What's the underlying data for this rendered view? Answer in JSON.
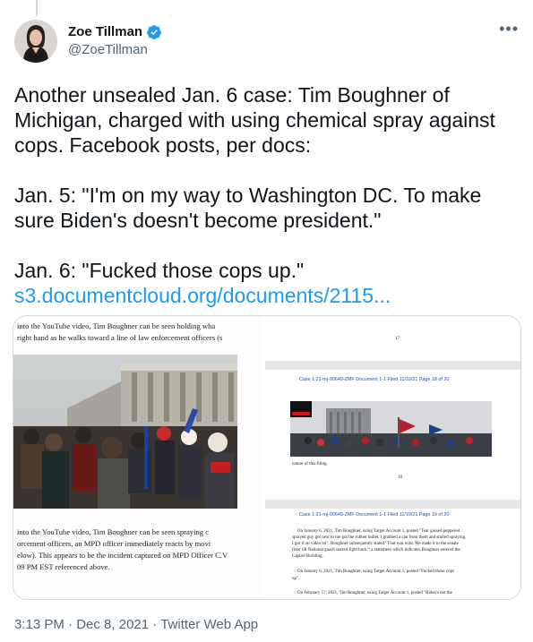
{
  "author": {
    "display_name": "Zoe Tillman",
    "handle": "@ZoeTillman",
    "verified": true,
    "verified_icon": "verified-badge-icon"
  },
  "more_icon": "ellipsis-icon",
  "tweet": {
    "paragraph_1": "Another unsealed Jan. 6 case: Tim Boughner of Michigan, charged with using chemical spray against cops. Facebook posts, per docs:",
    "paragraph_2": "Jan. 5: \"I'm on my way to Washington DC. To make sure Biden's doesn't become president.\"",
    "paragraph_3": "Jan. 6: \"Fucked those cops up.\"",
    "link": "s3.documentcloud.org/documents/2115..."
  },
  "media": {
    "left": {
      "top_line_1": "into the YouTube video, Tim Boughner can be seen holding wha",
      "top_line_2": "right hand as he walks toward a line of law enforcement officers (s",
      "bottom_line_1": "into the YouTube video, Tim Boughner can be seen spraying c",
      "bottom_line_2": "orcement officers, an MPD officer immediately reacts by movi",
      "bottom_line_3": "elow). This appears to be the incident captured on MPD Officer C.V",
      "bottom_line_4": "09 PM EST referenced above."
    },
    "right": {
      "page_number_top": "17",
      "header_1": "Case 1:21-mj-00649-ZMF   Document 1-1   Filed 11/10/21   Page 18 of 20",
      "caption": "nature of this filing.",
      "page_number_mid": "18",
      "header_2": "Case 1:21-mj-00649-ZMF   Document 1-1   Filed 11/10/21   Page 19 of 20",
      "para_1_line_1": "On January 6, 2021, Tim Boughner, using Target Account 1, posted \"Tear gassed peppered",
      "para_1_line_2": "sprayed guy got next to me got the rubber bullet. I grabbed a can from them and started spraying.",
      "para_1_line_3": "I got it on video lol\". Boughner subsequently stated \"That was wild. We made it to the senate",
      "para_1_line_4": "floor till National guard started fight back\"; a statement which indicates Boughner entered the",
      "para_1_line_5": "Capitol Building.",
      "para_2_line_1": "On January 6, 2021, Tim Boughner, using Target Account 1, posted \"Fucked those cops",
      "para_2_line_2": "up\".",
      "para_3_line_1": "On February 17, 2021, Tim Boughner, using Target Account 1, posted \"Biden's not the"
    }
  },
  "footer": {
    "time": "3:13 PM",
    "separator": "·",
    "date": "Dec 8, 2021",
    "source": "Twitter Web App"
  },
  "colors": {
    "accent": "#1d9bf0",
    "text": "#0f1419",
    "secondary": "#536471",
    "border": "#cfd9de"
  }
}
